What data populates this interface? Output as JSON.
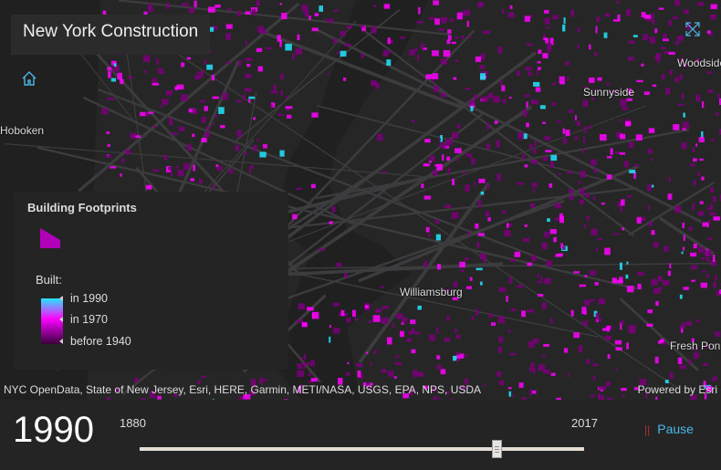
{
  "header": {
    "title": "New York Construction"
  },
  "map": {
    "labels": [
      "Hoboken",
      "Sunnyside",
      "Woodside",
      "Williamsburg",
      "Fresh Pon"
    ],
    "colors": {
      "old": "#7a007a",
      "mid": "#ff00ff",
      "new": "#22e6ff",
      "background": "#262627",
      "road": "#3c3c3e",
      "water": "#202021"
    }
  },
  "controls": {
    "home_icon": "home-icon",
    "fullscreen_icon": "expand-icon"
  },
  "legend": {
    "title": "Building Footprints",
    "field_label": "Built:",
    "stops": [
      "in 1990",
      "in 1970",
      "before 1940"
    ],
    "symbol_color": "#b000b8"
  },
  "attribution": {
    "sources": "NYC OpenData, State of New Jersey, Esri, HERE, Garmin, METI/NASA, USGS, EPA, NPS, USDA",
    "powered_by": "Powered by Esri"
  },
  "time_slider": {
    "current_year": "1990",
    "min_label": "1880",
    "max_label": "2017",
    "min": 1880,
    "max": 2017,
    "value": 1990,
    "pause_label": "Pause"
  }
}
